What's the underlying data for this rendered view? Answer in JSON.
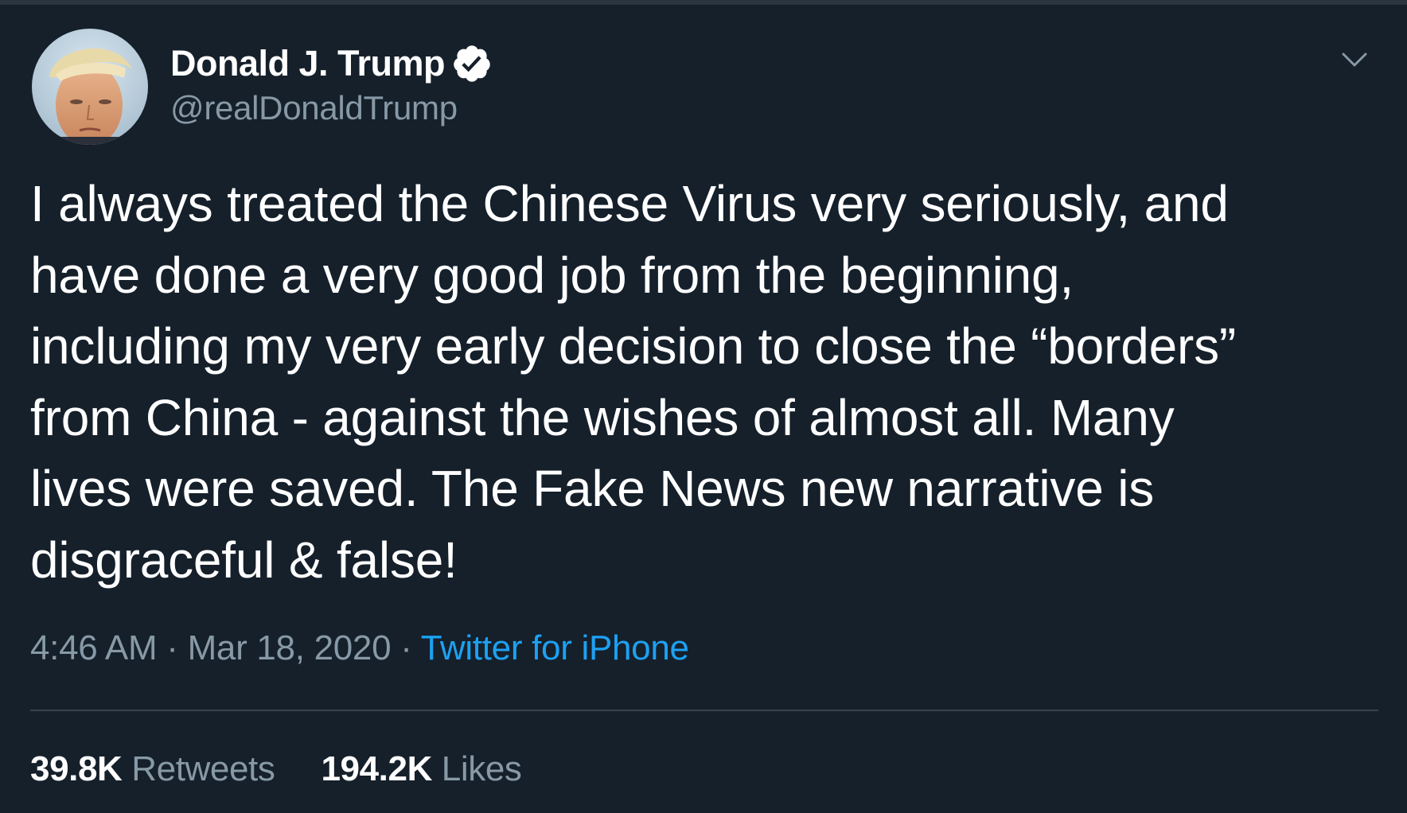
{
  "author": {
    "display_name": "Donald J. Trump",
    "handle": "@realDonaldTrump",
    "verified": true,
    "verified_icon": "verified-badge-icon"
  },
  "menu_icon": "chevron-down-icon",
  "tweet": {
    "text": "I always treated the Chinese Virus very seriously, and\nhave done a very good job from the beginning,\nincluding my very early decision to close the “borders”\nfrom China - against the wishes of almost all. Many\nlives were saved. The Fake News new narrative is\ndisgraceful & false!"
  },
  "meta": {
    "time": "4:46 AM",
    "separator": "·",
    "date": "Mar 18, 2020",
    "source": "Twitter for iPhone"
  },
  "stats": {
    "retweets_count": "39.8K",
    "retweets_label": "Retweets",
    "likes_count": "194.2K",
    "likes_label": "Likes"
  },
  "colors": {
    "background": "#15202b",
    "primary_text": "#ffffff",
    "secondary_text": "#8899a6",
    "accent": "#1da1f2",
    "divider": "#38444d"
  }
}
